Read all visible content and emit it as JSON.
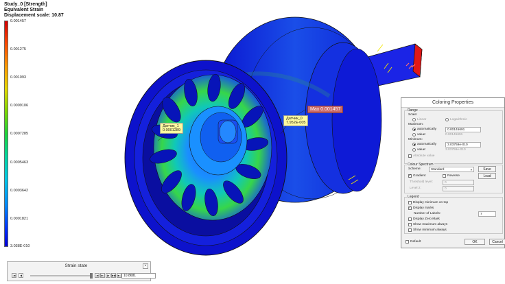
{
  "study": {
    "line1": "Study_0 [Strength]",
    "line2": "Equivalent Strain",
    "line3": "Displacement scale: 10.87"
  },
  "legend": {
    "ticks": [
      "0.001457",
      "0.001275",
      "0.001093",
      "0.0009106",
      "0.0007285",
      "0.0005463",
      "0.0003642",
      "0.0001821",
      "3.038E-010"
    ],
    "colors": {
      "max": "#d40000",
      "min": "#0000d8"
    }
  },
  "annotations": {
    "max_label": "Max 0.001457",
    "sensor1_name": "Датчик_1",
    "sensor1_value": "0.0001289",
    "sensor0_name": "Датчик_0",
    "sensor0_value": "7.952E-005"
  },
  "dialog": {
    "title": "Coloring Properties",
    "range": {
      "label": "Range",
      "scale_label": "Scale:",
      "linear": "Linear",
      "logarithmic": "Logarithmic",
      "maximum_label": "Maximum:",
      "max_auto": "automatically",
      "max_auto_value": "0.00145691",
      "max_value_label": "value:",
      "max_value_value": "0.00145691",
      "minimum_label": "Minimum:",
      "min_auto": "automatically",
      "min_auto_value": "3.03759e-010",
      "min_value_label": "value:",
      "min_value_value": "3.03759e-010",
      "absolute_value": "Absolute value"
    },
    "spectrum": {
      "label": "Colour Spectrum",
      "scheme_label": "Scheme:",
      "scheme_value": "Standard",
      "save": "Save",
      "load": "Load",
      "gradient": "Gradient",
      "reverse": "Reverse",
      "threshold_label": "Threshold level:",
      "threshold_value": "0",
      "level2_label": "Level 2:",
      "level2_value": "0"
    },
    "legend_group": {
      "label": "Legend",
      "display_min_on_top": "Display minimum on top",
      "display_marks": "Display marks",
      "number_of_labels_label": "Number of Labels:",
      "number_of_labels_value": "7",
      "display_zero_mark": "Display Zero Mark",
      "show_max_always": "Show maximum always",
      "show_min_always": "Show minimum always"
    },
    "default_label": "Default",
    "ok": "OK",
    "cancel": "Cancel"
  },
  "strain": {
    "title": "Strain state",
    "close": "×",
    "value": "10.8681",
    "buttons": [
      "|◀",
      "◀",
      "|◀",
      "▶|",
      "|▶",
      "▶▶",
      "▶|"
    ]
  }
}
